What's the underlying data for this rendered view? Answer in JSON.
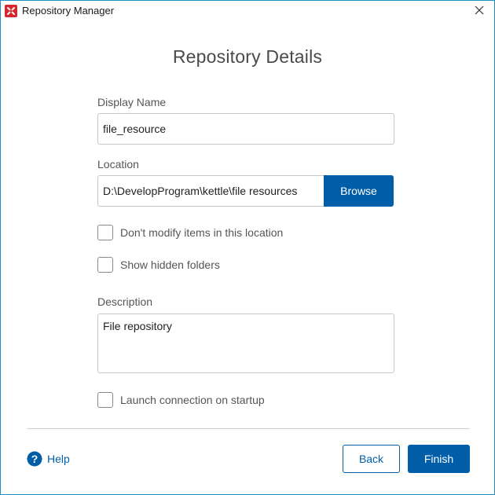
{
  "window": {
    "title": "Repository Manager",
    "app_icon": "pentaho-kettle-icon",
    "close_icon": "close-icon"
  },
  "heading": "Repository Details",
  "display_name": {
    "label": "Display Name",
    "value": "file_resource"
  },
  "location": {
    "label": "Location",
    "value": "D:\\DevelopProgram\\kettle\\file resources",
    "browse_label": "Browse"
  },
  "options": {
    "dont_modify": {
      "label": "Don't modify items in this location",
      "checked": false
    },
    "show_hidden": {
      "label": "Show hidden folders",
      "checked": false
    }
  },
  "description": {
    "label": "Description",
    "value": "File repository"
  },
  "launch_on_startup": {
    "label": "Launch connection on startup",
    "checked": false
  },
  "footer": {
    "help_label": "Help",
    "help_icon": "question-circle-icon",
    "back_label": "Back",
    "finish_label": "Finish"
  },
  "colors": {
    "accent": "#005ea8",
    "window_border": "#1e90c8",
    "app_icon_bg": "#d8262e"
  }
}
